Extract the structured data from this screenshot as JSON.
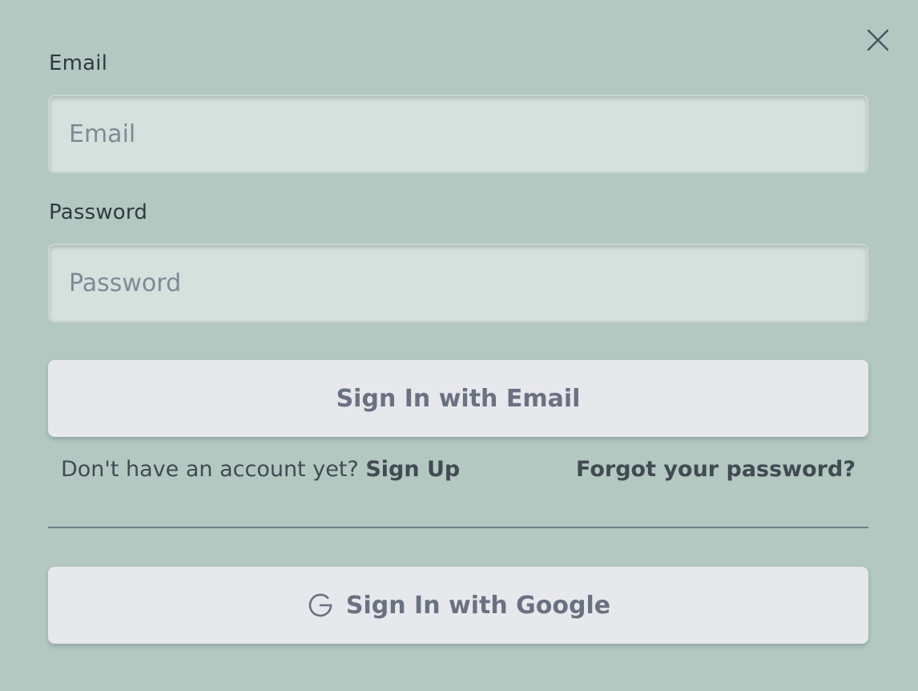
{
  "form": {
    "email_label": "Email",
    "email_placeholder": "Email",
    "email_value": "",
    "password_label": "Password",
    "password_placeholder": "Password",
    "password_value": "",
    "sign_in_email_label": "Sign In with Email",
    "no_account_text": "Don't have an account yet?",
    "sign_up_label": "Sign Up",
    "forgot_password_label": "Forgot your password?",
    "sign_in_google_label": "Sign In with Google"
  },
  "icons": {
    "close": "close-icon",
    "google": "google-icon"
  },
  "colors": {
    "background": "#b4c8c2",
    "input_background": "#d6e1de",
    "button_background": "#e7e8ec",
    "button_text": "#6a7181",
    "label_text": "#2f3a40",
    "placeholder_text": "#7e8a96"
  }
}
